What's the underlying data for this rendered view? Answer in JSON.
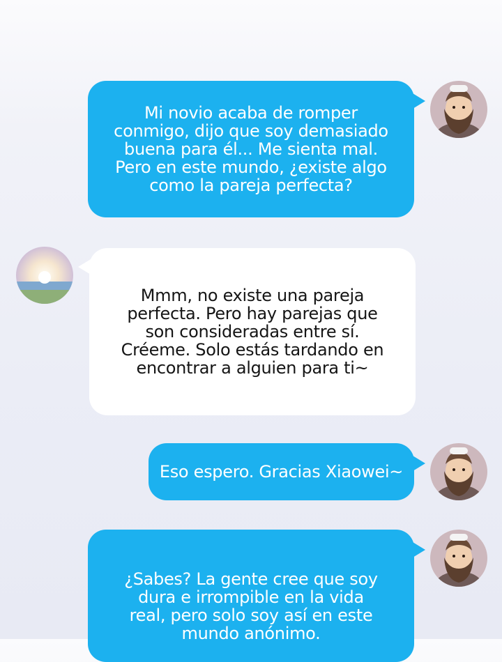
{
  "messages": [
    {
      "side": "sent",
      "text": "Mi novio acaba de romper\nconmigo, dijo que soy demasiado\nbuena para él... Me sienta mal.\nPero en este mundo, ¿existe algo\ncomo la pareja perfecta?",
      "avatar": "bearded-man-avatar-icon"
    },
    {
      "side": "received",
      "text": "Mmm, no existe una pareja\nperfecta. Pero hay parejas que\nson consideradas entre sí.\nCréeme. Solo estás tardando en\nencontrar a alguien para ti~",
      "avatar": "sunrise-landscape-avatar-icon"
    },
    {
      "side": "sent",
      "text": "Eso espero. Gracias Xiaowei~",
      "avatar": "bearded-man-avatar-icon"
    },
    {
      "side": "sent",
      "text": "¿Sabes? La gente cree que soy\ndura e irrompible en la vida\nreal, pero solo soy así en este\nmundo anónimo.",
      "avatar": "bearded-man-avatar-icon"
    }
  ],
  "colors": {
    "sent_bubble": "#1cb1ef",
    "received_bubble": "#ffffff",
    "sent_text": "#ffffff",
    "received_text": "#151515"
  }
}
